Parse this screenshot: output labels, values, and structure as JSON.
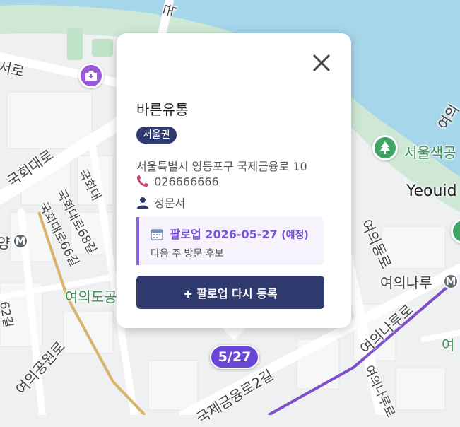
{
  "map": {
    "road_labels": [
      {
        "id": "r1",
        "text": "서로"
      },
      {
        "id": "r2",
        "text": "국회대로"
      },
      {
        "id": "r3",
        "text": "국회대로68길"
      },
      {
        "id": "r4",
        "text": "국회대로66길"
      },
      {
        "id": "r5",
        "text": "국회대"
      },
      {
        "id": "r6",
        "text": "62길"
      },
      {
        "id": "r7",
        "text": "여의공원로"
      },
      {
        "id": "r8",
        "text": "여의동로"
      },
      {
        "id": "r9",
        "text": "여의나루로"
      },
      {
        "id": "r10",
        "text": "여의나루로"
      },
      {
        "id": "r11",
        "text": "국제금융로2길"
      },
      {
        "id": "r12",
        "text": "여의"
      },
      {
        "id": "r13",
        "text": "국"
      }
    ],
    "place_labels": [
      {
        "id": "p1",
        "text": "여의도공"
      },
      {
        "id": "p2",
        "text": "서울색공"
      },
      {
        "id": "p3",
        "text": "Yeouid"
      },
      {
        "id": "p4",
        "text": "여의나루"
      },
      {
        "id": "p5",
        "text": "여"
      },
      {
        "id": "p6",
        "text": "양"
      }
    ],
    "metro_label": "M",
    "poi_icons": [
      "camera-plus-icon",
      "tree-icon"
    ],
    "colors": {
      "water": "#a6d6ea",
      "park": "#cfe8d5",
      "metro_line": "#7d4fc8",
      "road_major": "#d8b56a"
    }
  },
  "popup": {
    "title": "바른유통",
    "region_badge": "서울권",
    "address": "서울특별시 영등포구 국제금융로 10",
    "phone": "026666666",
    "manager": "정문서",
    "followup": {
      "label": "팔로업 2026-05-27",
      "status": "(예정)",
      "note": "다음 주 방문 후보"
    },
    "register_button": "+ 팔로업 다시 등록",
    "icons": {
      "close": "close-icon",
      "phone": "phone-icon",
      "person": "person-icon",
      "calendar": "calendar-icon"
    },
    "colors": {
      "accent": "#2f3b6e",
      "followup": "#7a4fe0"
    }
  },
  "marker": {
    "date": "5/27"
  }
}
